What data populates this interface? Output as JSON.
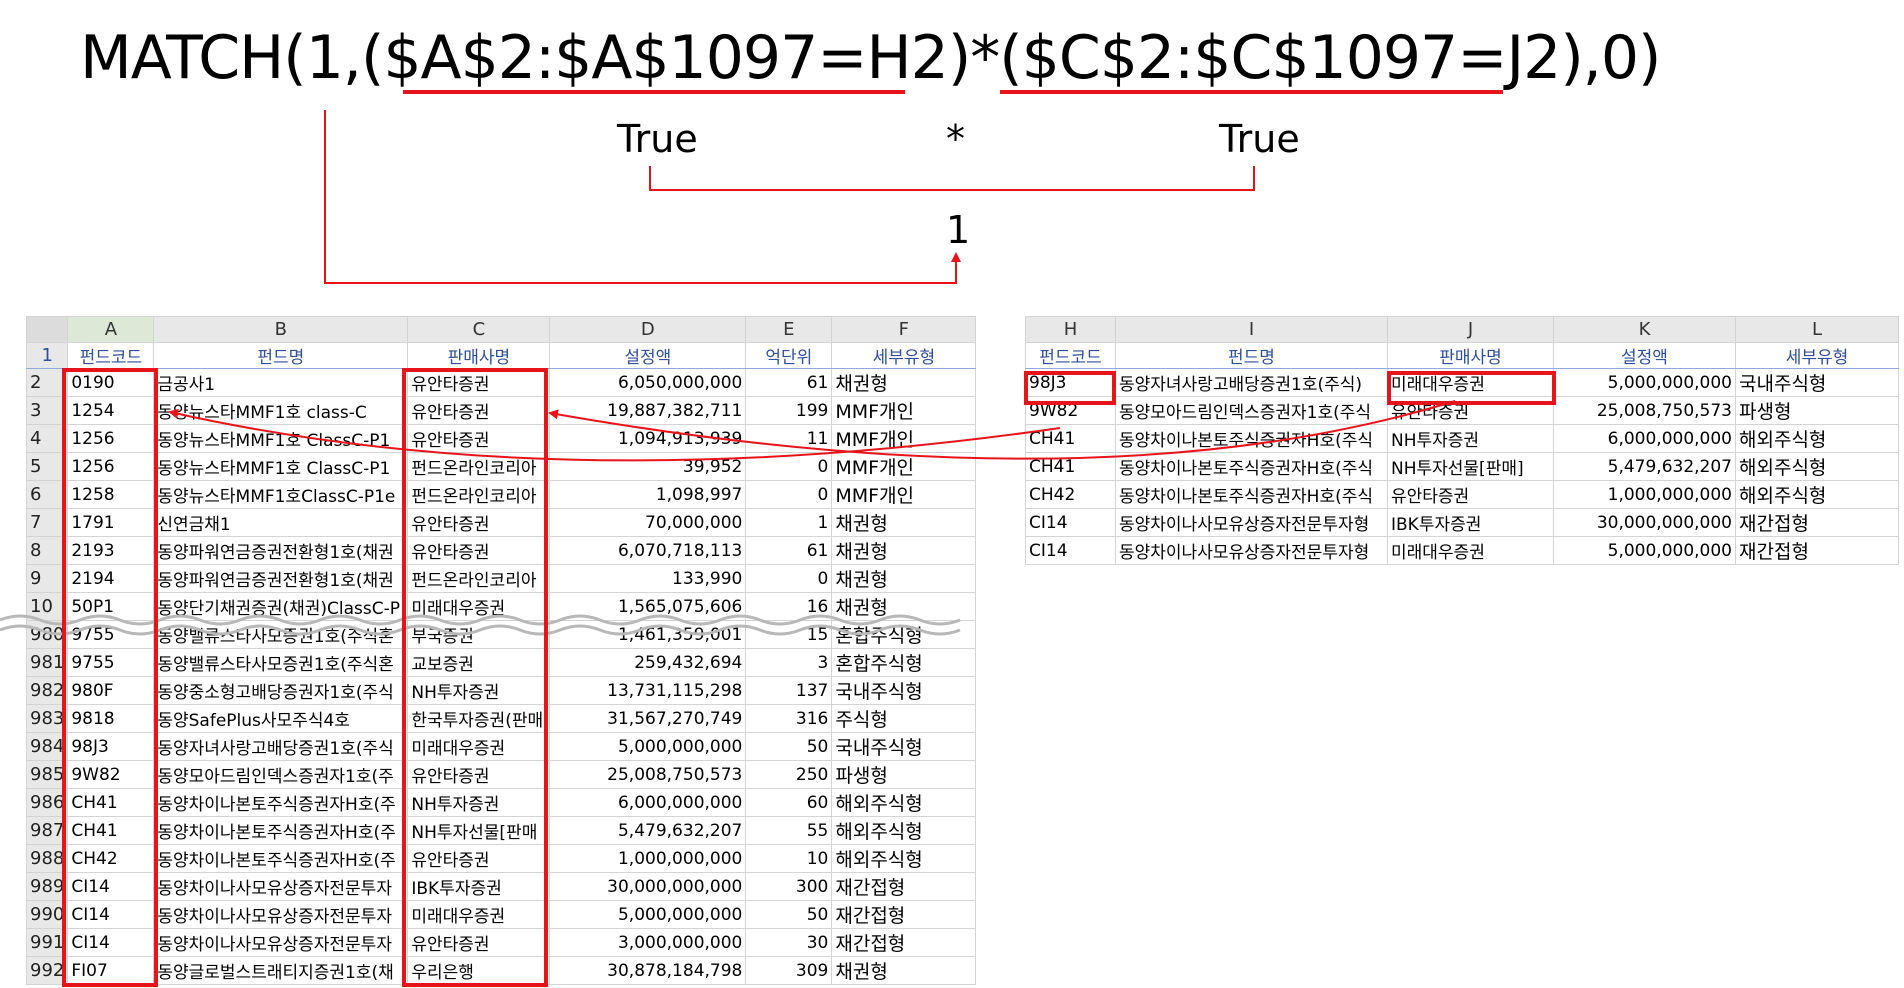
{
  "formula": {
    "prefix": "MATCH(1,(",
    "range_a": "$A$2:$A$1097=H2",
    "middle": ")*(",
    "range_c": "$C$2:$C$1097=J2",
    "suffix": "),0)"
  },
  "annotations": {
    "left_result": "True",
    "operator": "*",
    "right_result": "True",
    "product": "1"
  },
  "accent_color": "#e8141b",
  "left_sheet": {
    "columns": [
      "A",
      "B",
      "C",
      "D",
      "E",
      "F"
    ],
    "header": [
      "펀드코드",
      "펀드명",
      "판매사명",
      "설정액",
      "억단위",
      "세부유형"
    ],
    "rows": [
      {
        "rn": "2",
        "code": "0190",
        "name": "금공사1",
        "seller": "유안타증권",
        "amount": "6,050,000,000",
        "unit": "61",
        "type": "채권형"
      },
      {
        "rn": "3",
        "code": "1254",
        "name": "동양뉴스타MMF1호 class-C",
        "seller": "유안타증권",
        "amount": "19,887,382,711",
        "unit": "199",
        "type": "MMF개인"
      },
      {
        "rn": "4",
        "code": "1256",
        "name": "동양뉴스타MMF1호 ClassC-P1",
        "seller": "유안타증권",
        "amount": "1,094,913,939",
        "unit": "11",
        "type": "MMF개인"
      },
      {
        "rn": "5",
        "code": "1256",
        "name": "동양뉴스타MMF1호 ClassC-P1",
        "seller": "펀드온라인코리아",
        "amount": "39,952",
        "unit": "0",
        "type": "MMF개인"
      },
      {
        "rn": "6",
        "code": "1258",
        "name": "동양뉴스타MMF1호ClassC-P1e",
        "seller": "펀드온라인코리아",
        "amount": "1,098,997",
        "unit": "0",
        "type": "MMF개인"
      },
      {
        "rn": "7",
        "code": "1791",
        "name": "신연금채1",
        "seller": "유안타증권",
        "amount": "70,000,000",
        "unit": "1",
        "type": "채권형"
      },
      {
        "rn": "8",
        "code": "2193",
        "name": "동양파워연금증권전환형1호(채권",
        "seller": "유안타증권",
        "amount": "6,070,718,113",
        "unit": "61",
        "type": "채권형"
      },
      {
        "rn": "9",
        "code": "2194",
        "name": "동양파워연금증권전환형1호(채권",
        "seller": "펀드온라인코리아",
        "amount": "133,990",
        "unit": "0",
        "type": "채권형"
      },
      {
        "rn": "10",
        "code": "50P1",
        "name": "동양단기채권증권(채권)ClassC-P",
        "seller": "미래대우증권",
        "amount": "1,565,075,606",
        "unit": "16",
        "type": "채권형"
      },
      {
        "rn": "980",
        "code": "9755",
        "name": "동양밸류스타사모증권1호(주식혼",
        "seller": "부국증권",
        "amount": "1,461,359,001",
        "unit": "15",
        "type": "혼합주식형"
      },
      {
        "rn": "981",
        "code": "9755",
        "name": "동양밸류스타사모증권1호(주식혼",
        "seller": "교보증권",
        "amount": "259,432,694",
        "unit": "3",
        "type": "혼합주식형"
      },
      {
        "rn": "982",
        "code": "980F",
        "name": "동양중소형고배당증권자1호(주식",
        "seller": "NH투자증권",
        "amount": "13,731,115,298",
        "unit": "137",
        "type": "국내주식형"
      },
      {
        "rn": "983",
        "code": "9818",
        "name": "동양SafePlus사모주식4호",
        "seller": "한국투자증권(판매",
        "amount": "31,567,270,749",
        "unit": "316",
        "type": "주식형"
      },
      {
        "rn": "984",
        "code": "98J3",
        "name": "동양자녀사랑고배당증권1호(주식",
        "seller": "미래대우증권",
        "amount": "5,000,000,000",
        "unit": "50",
        "type": "국내주식형"
      },
      {
        "rn": "985",
        "code": "9W82",
        "name": "동양모아드림인덱스증권자1호(주",
        "seller": "유안타증권",
        "amount": "25,008,750,573",
        "unit": "250",
        "type": "파생형"
      },
      {
        "rn": "986",
        "code": "CH41",
        "name": "동양차이나본토주식증권자H호(주",
        "seller": "NH투자증권",
        "amount": "6,000,000,000",
        "unit": "60",
        "type": "해외주식형"
      },
      {
        "rn": "987",
        "code": "CH41",
        "name": "동양차이나본토주식증권자H호(주",
        "seller": "NH투자선물[판매",
        "amount": "5,479,632,207",
        "unit": "55",
        "type": "해외주식형"
      },
      {
        "rn": "988",
        "code": "CH42",
        "name": "동양차이나본토주식증권자H호(주",
        "seller": "유안타증권",
        "amount": "1,000,000,000",
        "unit": "10",
        "type": "해외주식형"
      },
      {
        "rn": "989",
        "code": "CI14",
        "name": "동양차이나사모유상증자전문투자",
        "seller": "IBK투자증권",
        "amount": "30,000,000,000",
        "unit": "300",
        "type": "재간접형"
      },
      {
        "rn": "990",
        "code": "CI14",
        "name": "동양차이나사모유상증자전문투자",
        "seller": "미래대우증권",
        "amount": "5,000,000,000",
        "unit": "50",
        "type": "재간접형"
      },
      {
        "rn": "991",
        "code": "CI14",
        "name": "동양차이나사모유상증자전문투자",
        "seller": "유안타증권",
        "amount": "3,000,000,000",
        "unit": "30",
        "type": "재간접형"
      },
      {
        "rn": "992",
        "code": "FI07",
        "name": "동양글로벌스트래티지증권1호(채",
        "seller": "우리은행",
        "amount": "30,878,184,798",
        "unit": "309",
        "type": "채권형"
      }
    ]
  },
  "right_sheet": {
    "columns": [
      "H",
      "I",
      "J",
      "K",
      "L"
    ],
    "header": [
      "펀드코드",
      "펀드명",
      "판매사명",
      "설정액",
      "세부유형"
    ],
    "rows": [
      {
        "code": "98J3",
        "name": "동양자녀사랑고배당증권1호(주식)",
        "seller": "미래대우증권",
        "amount": "5,000,000,000",
        "type": "국내주식형"
      },
      {
        "code": "9W82",
        "name": "동양모아드림인덱스증권자1호(주식",
        "seller": "유안타증권",
        "amount": "25,008,750,573",
        "type": "파생형"
      },
      {
        "code": "CH41",
        "name": "동양차이나본토주식증권자H호(주식",
        "seller": "NH투자증권",
        "amount": "6,000,000,000",
        "type": "해외주식형"
      },
      {
        "code": "CH41",
        "name": "동양차이나본토주식증권자H호(주식",
        "seller": "NH투자선물[판매]",
        "amount": "5,479,632,207",
        "type": "해외주식형"
      },
      {
        "code": "CH42",
        "name": "동양차이나본토주식증권자H호(주식",
        "seller": "유안타증권",
        "amount": "1,000,000,000",
        "type": "해외주식형"
      },
      {
        "code": "CI14",
        "name": "동양차이나사모유상증자전문투자형",
        "seller": "IBK투자증권",
        "amount": "30,000,000,000",
        "type": "재간접형"
      },
      {
        "code": "CI14",
        "name": "동양차이나사모유상증자전문투자형",
        "seller": "미래대우증권",
        "amount": "5,000,000,000",
        "type": "재간접형"
      }
    ]
  }
}
